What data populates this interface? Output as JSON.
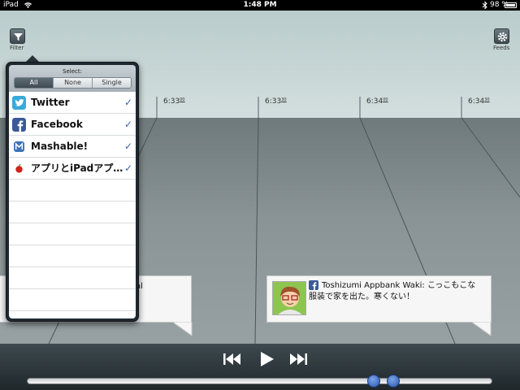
{
  "status_bar": {
    "device": "iPad",
    "time": "1:48 PM",
    "battery": "98 %"
  },
  "toolbar": {
    "filter_label": "Filter",
    "feeds_label": "Feeds"
  },
  "timeline": {
    "ticks": [
      {
        "time": "6:33",
        "sec": "00"
      },
      {
        "time": "6:33",
        "sec": "30"
      },
      {
        "time": "6:34",
        "sec": "00"
      },
      {
        "time": "6:34",
        "sec": "30"
      }
    ]
  },
  "filter_popover": {
    "title": "Select:",
    "segments": [
      "All",
      "None",
      "Single"
    ],
    "active_segment": "All",
    "feeds": [
      {
        "name": "Twitter",
        "checked": true,
        "icon": "twitter-icon"
      },
      {
        "name": "Facebook",
        "checked": true,
        "icon": "facebook-icon"
      },
      {
        "name": "Mashable!",
        "checked": true,
        "icon": "mashable-icon"
      },
      {
        "name": "アプリとiPadアプ…",
        "checked": true,
        "icon": "apple-icon"
      }
    ],
    "check_mark": "✓"
  },
  "posts": [
    {
      "partial_text": "al"
    },
    {
      "author": "Toshizumi Appbank Waki:",
      "text_line1": "こっこもこな",
      "text_line2": "服装で家を出た。寒くない！"
    }
  ],
  "playback": {
    "controls": [
      "rewind",
      "play",
      "fast-forward"
    ],
    "range_start": 0.746,
    "range_end": 0.787
  },
  "colors": {
    "accent": "#3e61b5",
    "twitter": "#39a9d8",
    "facebook": "#3b5998",
    "knob": "#2b57b0"
  }
}
